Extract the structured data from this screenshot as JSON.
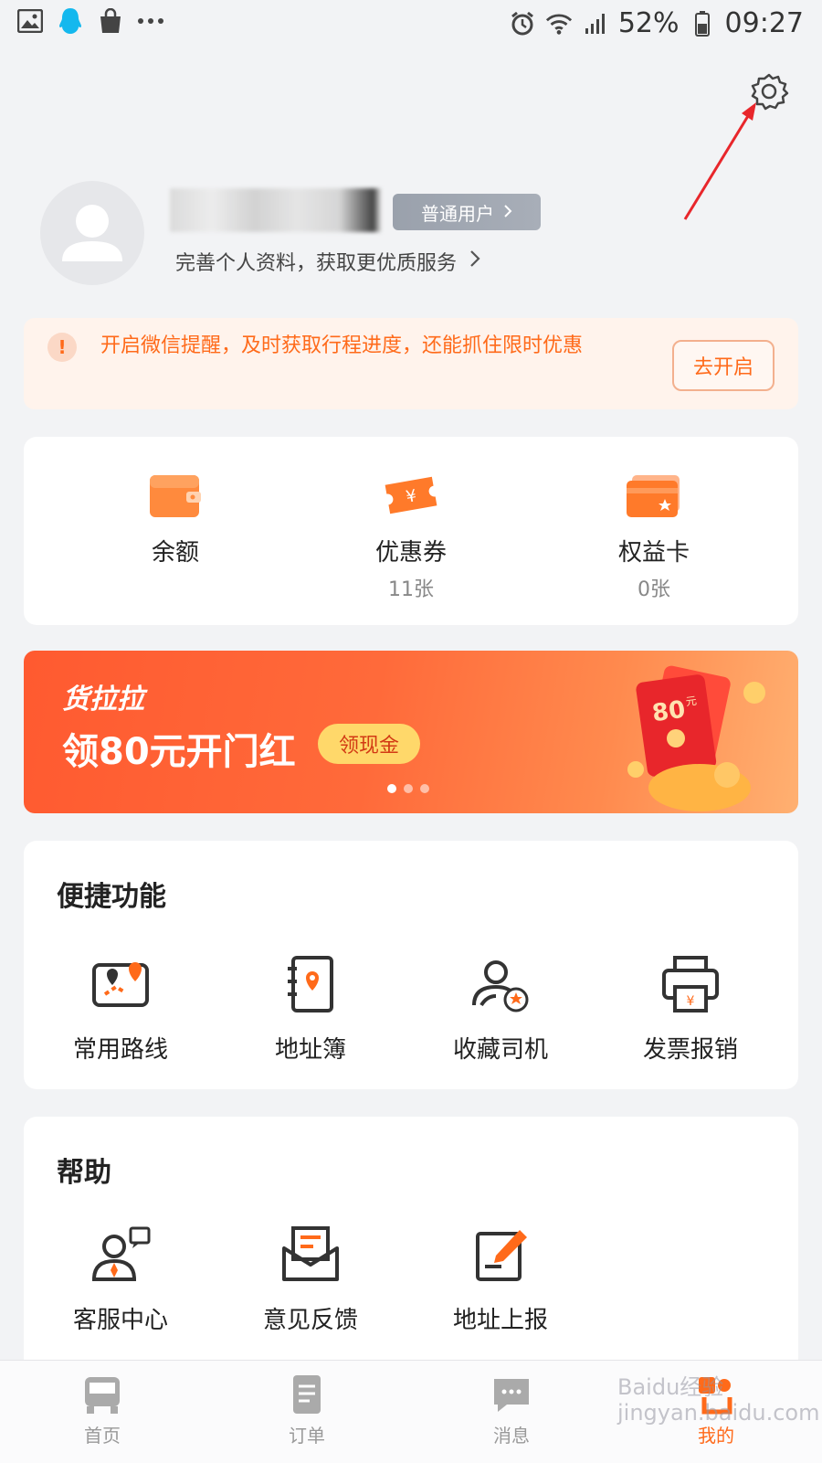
{
  "status_bar": {
    "battery": "52%",
    "time": "09:27",
    "left_icons": [
      "gallery-icon",
      "qq-icon",
      "shopping-bag-icon",
      "more-dots-icon"
    ],
    "right_icons": [
      "alarm-icon",
      "wifi-icon",
      "signal-icon",
      "battery-icon"
    ]
  },
  "profile": {
    "badge_label": "普通用户",
    "improve_text": "完善个人资料，获取更优质服务"
  },
  "notice": {
    "text": "开启微信提醒，及时获取行程进度，还能抓住限时优惠",
    "button_label": "去开启"
  },
  "assets": [
    {
      "label": "余额",
      "sub": ""
    },
    {
      "label": "优惠券",
      "sub": "11张"
    },
    {
      "label": "权益卡",
      "sub": "0张"
    }
  ],
  "banner": {
    "brand": "货拉拉",
    "headline": "领80元开门红",
    "pill": "领现金",
    "envelope_amount": "80",
    "envelope_unit": "元",
    "slides": 3,
    "active_slide": 1
  },
  "quick": {
    "title": "便捷功能",
    "items": [
      {
        "label": "常用路线"
      },
      {
        "label": "地址簿"
      },
      {
        "label": "收藏司机"
      },
      {
        "label": "发票报销"
      }
    ]
  },
  "help": {
    "title": "帮助",
    "items": [
      {
        "label": "客服中心"
      },
      {
        "label": "意见反馈"
      },
      {
        "label": "地址上报"
      }
    ]
  },
  "nav": [
    {
      "label": "首页"
    },
    {
      "label": "订单"
    },
    {
      "label": "消息"
    },
    {
      "label": "我的"
    }
  ],
  "watermark": "Baidu经验 jingyan.baidu.com",
  "colors": {
    "accent": "#ff6a1a",
    "background": "#f2f3f5"
  }
}
